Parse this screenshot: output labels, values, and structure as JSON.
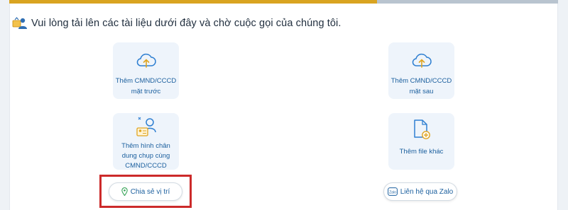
{
  "progress": {
    "fraction": 0.67,
    "fill_color": "#d9a421",
    "track_color": "#b9c4cf"
  },
  "instruction": {
    "icon": "user-upload-icon",
    "text": "Vui lòng tải lên các tài liệu dưới đây và chờ cuộc gọi của chúng tôi."
  },
  "cards": {
    "front": {
      "icon": "cloud-upload-icon",
      "line1": "Thêm CMND/CCCD",
      "line2": "mặt trước"
    },
    "back": {
      "icon": "cloud-upload-icon",
      "line1": "Thêm CMND/CCCD",
      "line2": "mặt sau"
    },
    "portrait": {
      "icon": "person-id-card-icon",
      "line1": "Thêm hình chân",
      "line2": "dung chụp cùng",
      "line3": "CMND/CCCD"
    },
    "other": {
      "icon": "file-add-icon",
      "line1": "Thêm file khác"
    }
  },
  "actions": {
    "location": {
      "icon": "map-pin-icon",
      "label": "Chia sẻ vị trí"
    },
    "zalo": {
      "icon": "zalo-icon",
      "label": "Liên hệ qua Zalo"
    }
  },
  "colors": {
    "accent": "#1b5f9e",
    "card_bg": "#eef4fb",
    "highlight": "#cc2a2a"
  }
}
